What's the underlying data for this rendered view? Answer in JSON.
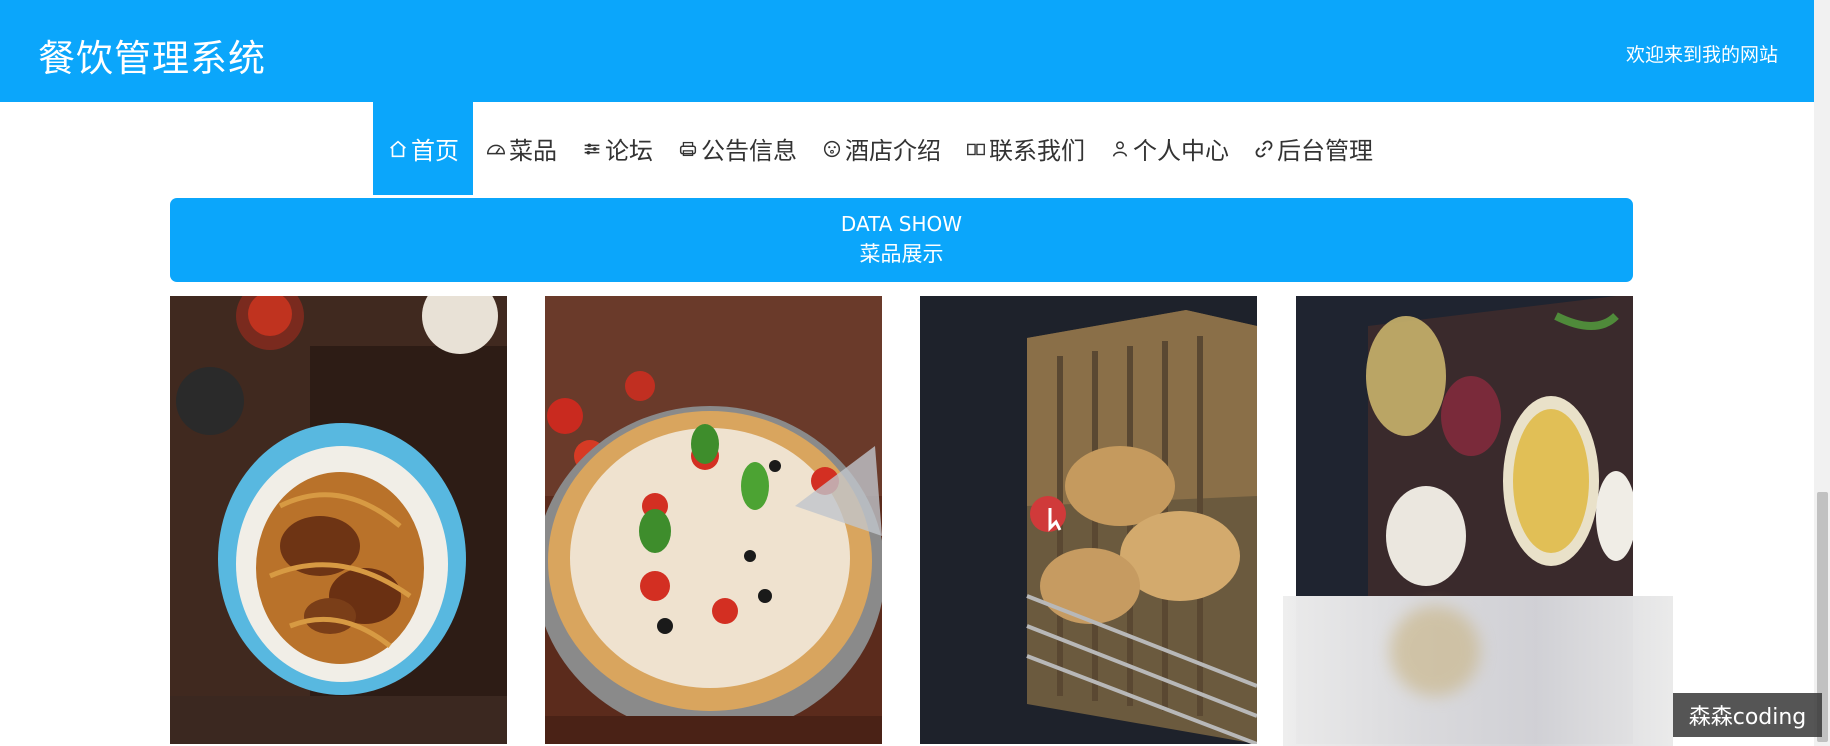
{
  "header": {
    "site_title": "餐饮管理系统",
    "welcome": "欢迎来到我的网站",
    "background_color": "#0ba6fb"
  },
  "nav": {
    "items": [
      {
        "label": "首页",
        "icon": "home-icon",
        "active": true
      },
      {
        "label": "菜品",
        "icon": "gauge-icon",
        "active": false
      },
      {
        "label": "论坛",
        "icon": "sliders-icon",
        "active": false
      },
      {
        "label": "公告信息",
        "icon": "printer-icon",
        "active": false
      },
      {
        "label": "酒店介绍",
        "icon": "face-icon",
        "active": false
      },
      {
        "label": "联系我们",
        "icon": "contact-card-icon",
        "active": false
      },
      {
        "label": "个人中心",
        "icon": "user-icon",
        "active": false
      },
      {
        "label": "后台管理",
        "icon": "link-icon",
        "active": false
      }
    ]
  },
  "banner": {
    "title_en": "DATA SHOW",
    "title_cn": "菜品展示"
  },
  "gallery": {
    "cards": [
      {
        "name": "dish-noodles-image"
      },
      {
        "name": "dish-pizza-image"
      },
      {
        "name": "dish-bread-image"
      },
      {
        "name": "dish-platter-image"
      }
    ]
  },
  "watermark": {
    "text": "森森coding"
  }
}
